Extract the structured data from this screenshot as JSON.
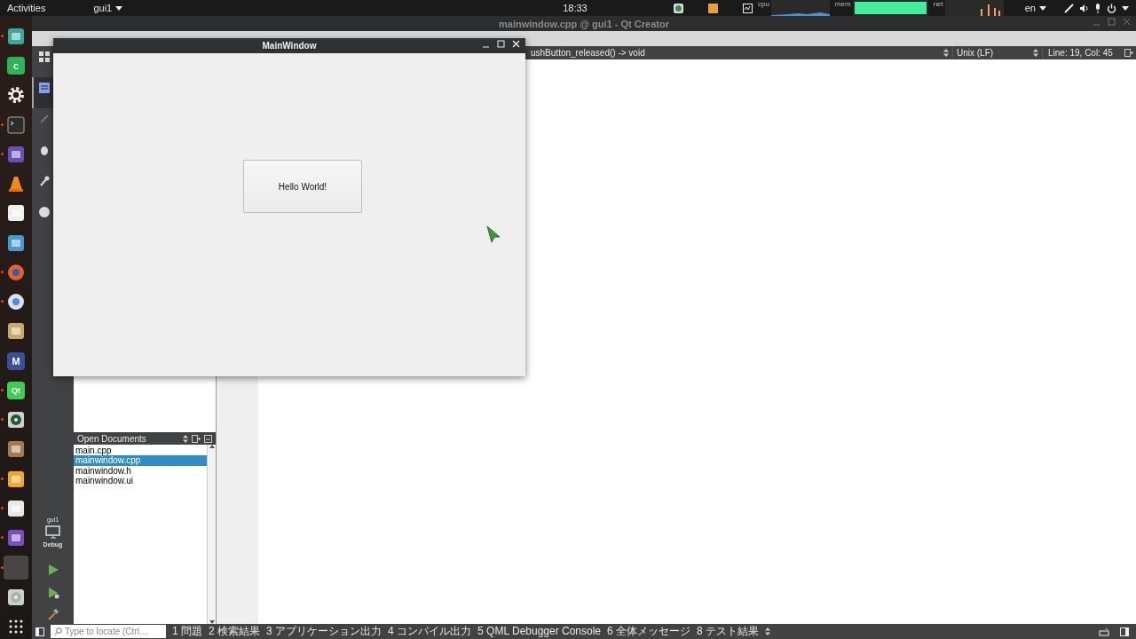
{
  "top_bar": {
    "activities": "Activities",
    "app_menu": "gui1",
    "clock": "18:33",
    "monitors": [
      {
        "label": "cpu"
      },
      {
        "label": "mem"
      },
      {
        "label": "net"
      }
    ],
    "language": "en"
  },
  "dock": [
    {
      "running": true,
      "selected": false
    },
    {
      "running": false,
      "selected": false,
      "glyph": "c"
    },
    {
      "running": false,
      "selected": false
    },
    {
      "running": true,
      "selected": false
    },
    {
      "running": true,
      "selected": false
    },
    {
      "running": false,
      "selected": false
    },
    {
      "running": false,
      "selected": false
    },
    {
      "running": false,
      "selected": false
    },
    {
      "running": true,
      "selected": false
    },
    {
      "running": true,
      "selected": false
    },
    {
      "running": false,
      "selected": false
    },
    {
      "running": false,
      "selected": false,
      "glyph": "M"
    },
    {
      "running": true,
      "selected": false,
      "glyph": "Qt"
    },
    {
      "running": true,
      "selected": false
    },
    {
      "running": false,
      "selected": false
    },
    {
      "running": true,
      "selected": false
    },
    {
      "running": true,
      "selected": false
    },
    {
      "running": true,
      "selected": false
    },
    {
      "running": true,
      "selected": true
    },
    {
      "running": false,
      "selected": false
    },
    {
      "running": false,
      "selected": false
    }
  ],
  "creator": {
    "title": "mainwindow.cpp @ gui1 - Qt Creator",
    "modes": [
      {
        "selected": false
      },
      {
        "selected": true
      },
      {
        "selected": false
      },
      {
        "selected": false
      },
      {
        "selected": false
      },
      {
        "selected": false
      }
    ],
    "kit": {
      "project": "gui1",
      "build": "Debug"
    },
    "editor_toolbar": {
      "function": "ushButton_released() -> void",
      "line_endings": "Unix (LF)",
      "position": "Line: 19, Col: 45"
    },
    "open_documents": {
      "title": "Open Documents",
      "items": [
        {
          "name": "main.cpp",
          "selected": false
        },
        {
          "name": "mainwindow.cpp",
          "selected": true
        },
        {
          "name": "mainwindow.h",
          "selected": false
        },
        {
          "name": "mainwindow.ui",
          "selected": false
        }
      ]
    },
    "status_bar": {
      "locate": {
        "placeholder": "Type to locate (Ctrl…"
      },
      "panes": [
        "1 問題",
        "2 検索結果",
        "3 アプリケーション出力",
        "4 コンパイル出力",
        "5 QML Debugger Console",
        "6 全体メッセージ",
        "8 テスト結果"
      ]
    }
  },
  "app_window": {
    "title": "MainWindow",
    "button": "Hello World!"
  }
}
